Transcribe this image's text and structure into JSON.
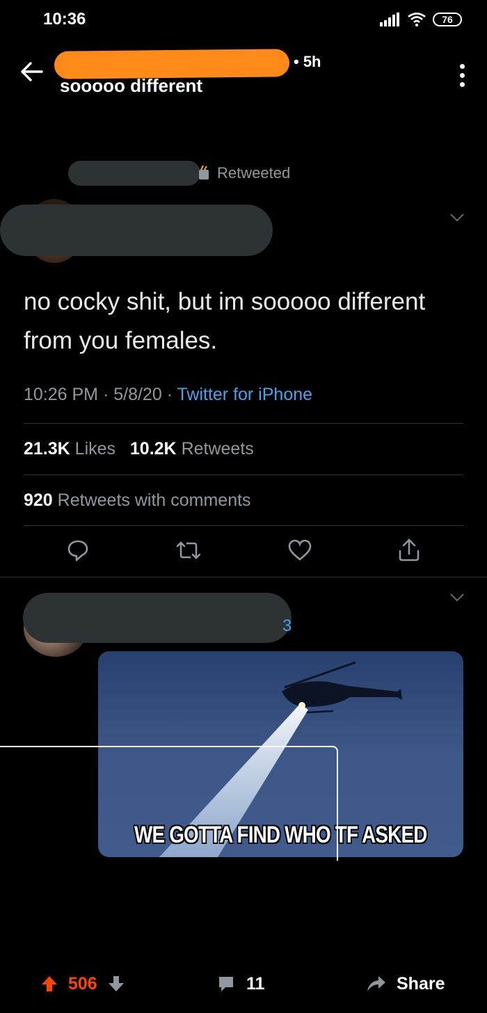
{
  "status_bar": {
    "time": "10:36",
    "battery": "76"
  },
  "header": {
    "age": "• 5h",
    "title": "sooooo different"
  },
  "retweet": {
    "label": "Retweeted"
  },
  "tweet": {
    "text": "no cocky shit, but im sooooo different from you females.",
    "time": "10:26 PM · 5/8/20 · ",
    "source": "Twitter for iPhone",
    "likes_count": "21.3K",
    "likes_label": "Likes",
    "retweets_count": "10.2K",
    "retweets_label": "Retweets",
    "quotes_count": "920",
    "quotes_label": "Retweets with comments"
  },
  "reply": {
    "partial_text": "3",
    "image_caption": "WE GOTTA FIND WHO TF ASKED"
  },
  "footer": {
    "upvotes": "506",
    "comments": "11",
    "share_label": "Share"
  },
  "colors": {
    "accent_link": "#4aa3e8",
    "upvote": "#ff4500",
    "redaction": "#ff8a1a"
  }
}
